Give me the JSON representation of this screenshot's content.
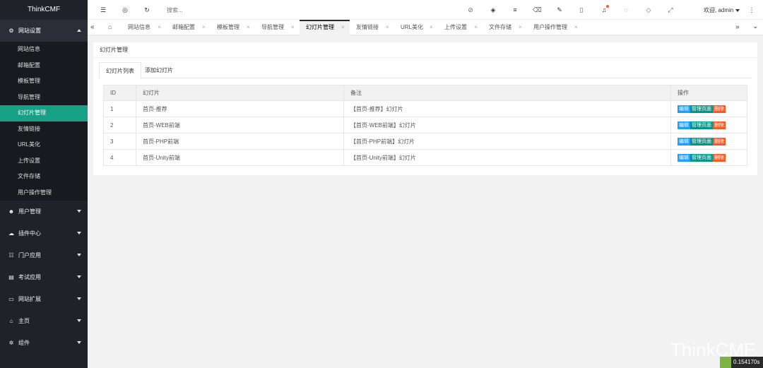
{
  "brand": "ThinkCMF",
  "sidebar": {
    "groups": [
      {
        "label": "网站设置",
        "icon": "gears-icon",
        "open": true
      },
      {
        "label": "用户管理",
        "icon": "users-icon"
      },
      {
        "label": "插件中心",
        "icon": "cloud-icon"
      },
      {
        "label": "门户应用",
        "icon": "grid-icon"
      },
      {
        "label": "考试应用",
        "icon": "file-icon"
      },
      {
        "label": "网站扩展",
        "icon": "desktop-icon"
      },
      {
        "label": "主页",
        "icon": "home-icon"
      },
      {
        "label": "组件",
        "icon": "gear-icon"
      }
    ],
    "subitems": [
      "网站信息",
      "邮箱配置",
      "模板管理",
      "导航管理",
      "幻灯片管理",
      "友情链接",
      "URL美化",
      "上传设置",
      "文件存储",
      "用户操作管理"
    ],
    "active_subitem": "幻灯片管理"
  },
  "header": {
    "search_placeholder": "搜索...",
    "user_label": "欢迎, admin"
  },
  "tabs": [
    {
      "label": "网站信息"
    },
    {
      "label": "邮箱配置"
    },
    {
      "label": "模板管理"
    },
    {
      "label": "导航管理"
    },
    {
      "label": "幻灯片管理",
      "active": true
    },
    {
      "label": "友情链接"
    },
    {
      "label": "URL美化"
    },
    {
      "label": "上传设置"
    },
    {
      "label": "文件存储"
    },
    {
      "label": "用户操作管理"
    }
  ],
  "panel": {
    "title": "幻灯片管理",
    "subtabs": [
      "幻灯片列表",
      "添加幻灯片"
    ]
  },
  "table": {
    "columns": [
      "ID",
      "幻灯片",
      "备注",
      "操作"
    ],
    "rows": [
      {
        "id": "1",
        "name": "首页-推荐",
        "remark": "【首页-推荐】幻灯片"
      },
      {
        "id": "2",
        "name": "首页-WEB前端",
        "remark": "【首页-WEB前端】幻灯片"
      },
      {
        "id": "3",
        "name": "首页-PHP前端",
        "remark": "【首页-PHP前端】幻灯片"
      },
      {
        "id": "4",
        "name": "首页-Unity前端",
        "remark": "【首页-Unity前端】幻灯片"
      }
    ],
    "actions": {
      "edit": "编辑",
      "manage": "管理页面",
      "delete": "删除"
    }
  },
  "watermark": "ThinkCMF",
  "timer": "0.154170s",
  "colors": {
    "sidebar": "#20222a",
    "active": "#16a085",
    "blue": "#1e9fff",
    "green": "#009688",
    "red": "#ff5722"
  }
}
